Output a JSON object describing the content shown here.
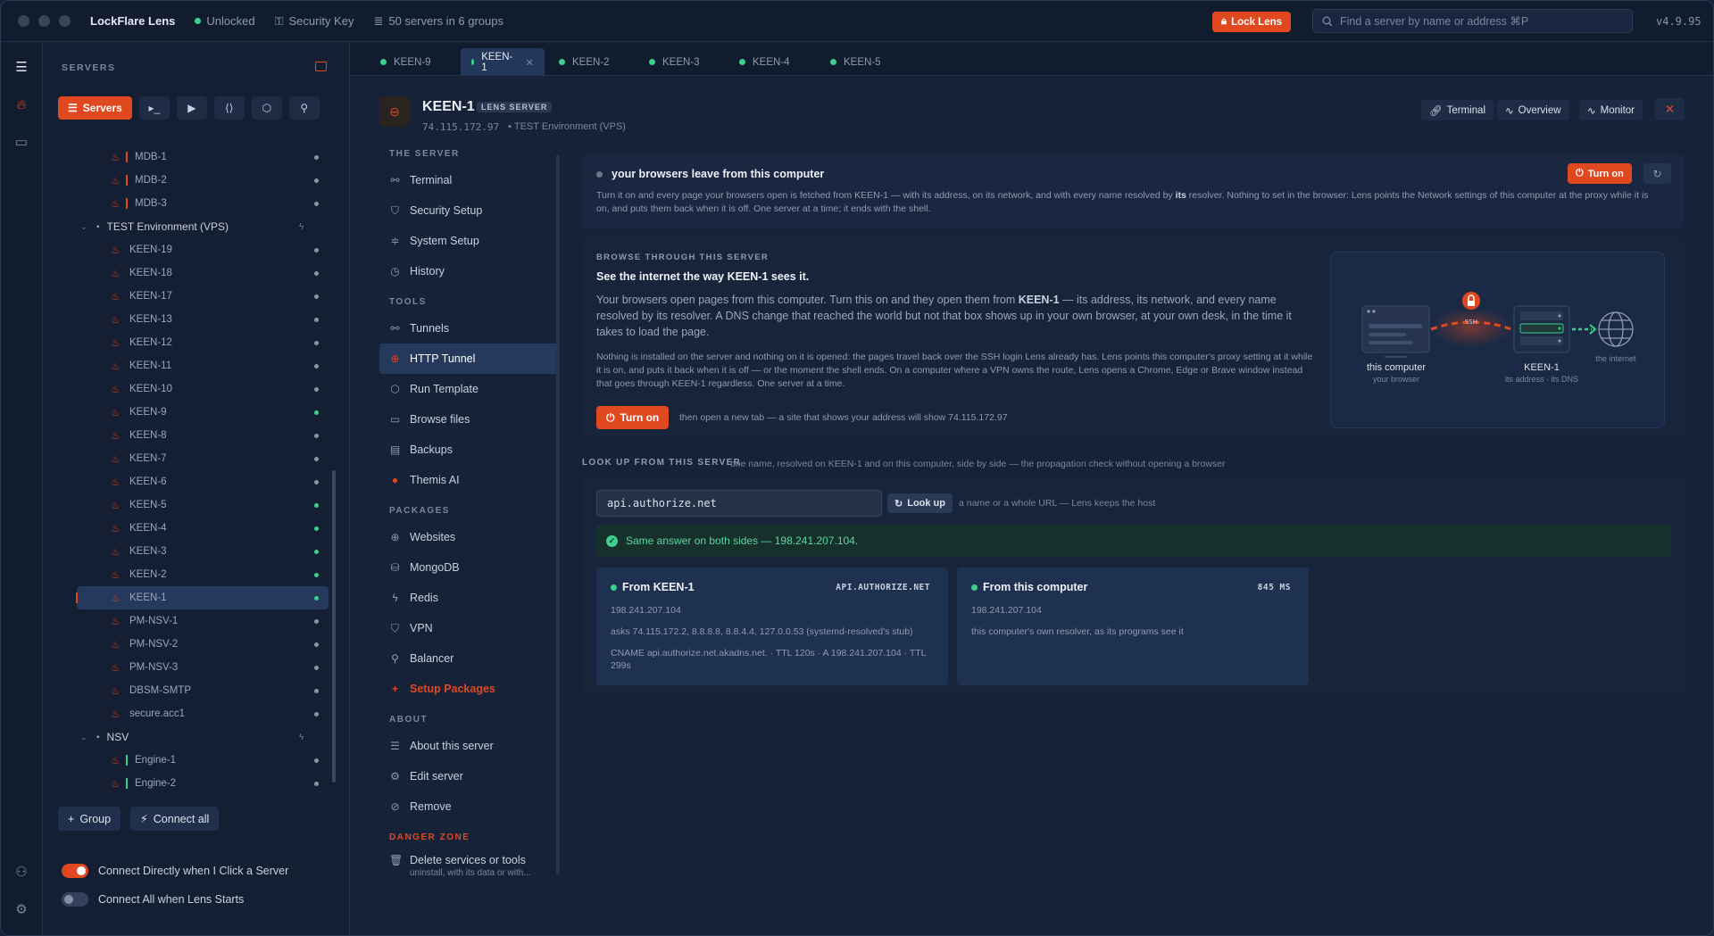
{
  "app": {
    "name": "LockFlare Lens",
    "status": "Unlocked",
    "security_key": "Security Key",
    "servers_summary": "50 servers in 6 groups",
    "lock_label": "Lock Lens",
    "search_placeholder": "Find a server by name or address  ⌘P",
    "version": "v4.9.95"
  },
  "sidebar": {
    "header": "SERVERS",
    "active_tab": "Servers",
    "tree": [
      {
        "type": "server",
        "label": "MDB-1",
        "bar": "#e0481f",
        "indent": 2,
        "on": false
      },
      {
        "type": "server",
        "label": "MDB-2",
        "bar": "#e0481f",
        "indent": 2,
        "on": false
      },
      {
        "type": "server",
        "label": "MDB-3",
        "bar": "#e0481f",
        "indent": 2,
        "on": false
      },
      {
        "type": "group",
        "label": "TEST Environment (VPS)"
      },
      {
        "type": "server",
        "label": "KEEN-19",
        "indent": 1,
        "on": false
      },
      {
        "type": "server",
        "label": "KEEN-18",
        "indent": 1,
        "on": false
      },
      {
        "type": "server",
        "label": "KEEN-17",
        "indent": 1,
        "on": false
      },
      {
        "type": "server",
        "label": "KEEN-13",
        "indent": 1,
        "on": false
      },
      {
        "type": "server",
        "label": "KEEN-12",
        "indent": 1,
        "on": false
      },
      {
        "type": "server",
        "label": "KEEN-11",
        "indent": 1,
        "on": false
      },
      {
        "type": "server",
        "label": "KEEN-10",
        "indent": 1,
        "on": false
      },
      {
        "type": "server",
        "label": "KEEN-9",
        "indent": 1,
        "on": true
      },
      {
        "type": "server",
        "label": "KEEN-8",
        "indent": 1,
        "on": false
      },
      {
        "type": "server",
        "label": "KEEN-7",
        "indent": 1,
        "on": false
      },
      {
        "type": "server",
        "label": "KEEN-6",
        "indent": 1,
        "on": false
      },
      {
        "type": "server",
        "label": "KEEN-5",
        "indent": 1,
        "on": true
      },
      {
        "type": "server",
        "label": "KEEN-4",
        "indent": 1,
        "on": true
      },
      {
        "type": "server",
        "label": "KEEN-3",
        "indent": 1,
        "on": true
      },
      {
        "type": "server",
        "label": "KEEN-2",
        "indent": 1,
        "on": true
      },
      {
        "type": "server",
        "label": "KEEN-1",
        "indent": 1,
        "on": true,
        "selected": true
      },
      {
        "type": "server",
        "label": "PM-NSV-1",
        "indent": 1,
        "on": false
      },
      {
        "type": "server",
        "label": "PM-NSV-2",
        "indent": 1,
        "on": false
      },
      {
        "type": "server",
        "label": "PM-NSV-3",
        "indent": 1,
        "on": false
      },
      {
        "type": "server",
        "label": "DBSM-SMTP",
        "indent": 1,
        "on": false
      },
      {
        "type": "server",
        "label": "secure.acc1",
        "indent": 1,
        "on": false
      },
      {
        "type": "group",
        "label": "NSV"
      },
      {
        "type": "server",
        "label": "Engine-1",
        "bar": "#3ecf8e",
        "indent": 2,
        "on": false
      },
      {
        "type": "server",
        "label": "Engine-2",
        "bar": "#3ecf8e",
        "indent": 2,
        "on": false
      }
    ],
    "group_button": "Group",
    "connect_all_button": "Connect all",
    "toggle_direct": "Connect Directly when I Click a Server",
    "toggle_all": "Connect All when Lens Starts"
  },
  "tabs": [
    "KEEN-9",
    "KEEN-1",
    "KEEN-2",
    "KEEN-3",
    "KEEN-4",
    "KEEN-5"
  ],
  "server": {
    "name": "KEEN-1",
    "badge": "LENS SERVER",
    "ip": "74.115.172.97",
    "group": "TEST Environment (VPS)",
    "btn_terminal": "Terminal",
    "btn_overview": "Overview",
    "btn_monitor": "Monitor"
  },
  "nav": {
    "sec_server": "THE SERVER",
    "terminal": "Terminal",
    "security_setup": "Security Setup",
    "system_setup": "System Setup",
    "history": "History",
    "sec_tools": "TOOLS",
    "tunnels": "Tunnels",
    "http_tunnel": "HTTP Tunnel",
    "run_template": "Run Template",
    "browse_files": "Browse files",
    "backups": "Backups",
    "themis": "Themis AI",
    "sec_packages": "PACKAGES",
    "websites": "Websites",
    "mongodb": "MongoDB",
    "redis": "Redis",
    "vpn": "VPN",
    "balancer": "Balancer",
    "setup_packages": "Setup Packages",
    "sec_about": "ABOUT",
    "about": "About this server",
    "edit": "Edit server",
    "remove": "Remove",
    "sec_danger": "DANGER ZONE",
    "delete": "Delete services or tools",
    "delete_sub": "uninstall, with its data or with..."
  },
  "proxy": {
    "title": "your browsers leave from this computer",
    "desc_a": "Turn it on and every page your browsers open is fetched from KEEN-1 — with its address, on its network, and with every name resolved by ",
    "desc_b": "its",
    "desc_c": " resolver. Nothing to set in the browser: Lens points the Network settings of this computer at the proxy while it is on, and puts them back when it is off. One server at a time; it ends with the shell.",
    "turn_on": "Turn on"
  },
  "browse": {
    "section": "BROWSE THROUGH THIS SERVER",
    "heading": "See the internet the way KEEN-1 sees it.",
    "p1_a": "Your browsers open pages from this computer. Turn this on and they open them from ",
    "p1_b": "KEEN-1",
    "p1_c": " — its address, its network, and every name resolved by its resolver. A DNS change that reached the world but not that box shows up in your own browser, at your own desk, in the time it takes to load the page.",
    "p2": "Nothing is installed on the server and nothing on it is opened: the pages travel back over the SSH login Lens already has. Lens points this computer's proxy setting at it while it is on, and puts it back when it is off — or the moment the shell ends. On a computer where a VPN owns the route, Lens opens a Chrome, Edge or Brave window instead that goes through KEEN-1 regardless. One server at a time.",
    "turn_on": "Turn on",
    "hint": "then open a new tab — a site that shows your address will show 74.115.172.97",
    "illus": {
      "local": "this computer",
      "local_sub": "your browser",
      "ssh": "SSH",
      "remote": "KEEN-1",
      "remote_sub": "its address · its DNS",
      "net": "the internet"
    }
  },
  "lookup": {
    "section": "LOOK UP FROM THIS SERVER",
    "section_hint": "one name, resolved on KEEN-1 and on this computer, side by side — the propagation check without opening a browser",
    "value": "api.authorize.net",
    "button": "Look up",
    "hint": "a name or a whole URL — Lens keeps the host",
    "result": "Same answer on both sides — 198.241.207.104.",
    "remote": {
      "title": "From KEEN-1",
      "tag": "API.AUTHORIZE.NET",
      "ip": "198.241.207.104",
      "asks": "asks 74.115.172.2, 8.8.8.8, 8.8.4.4, 127.0.0.53 (systemd-resolved's stub)",
      "cname": "CNAME api.authorize.net.akadns.net. · TTL 120s · A 198.241.207.104 · TTL 299s"
    },
    "local": {
      "title": "From this computer",
      "tag": "845 MS",
      "ip": "198.241.207.104",
      "note": "this computer's own resolver, as its programs see it"
    }
  },
  "colors": {
    "accent": "#e0481f",
    "ok": "#3ecf8e",
    "bg": "#162238"
  }
}
